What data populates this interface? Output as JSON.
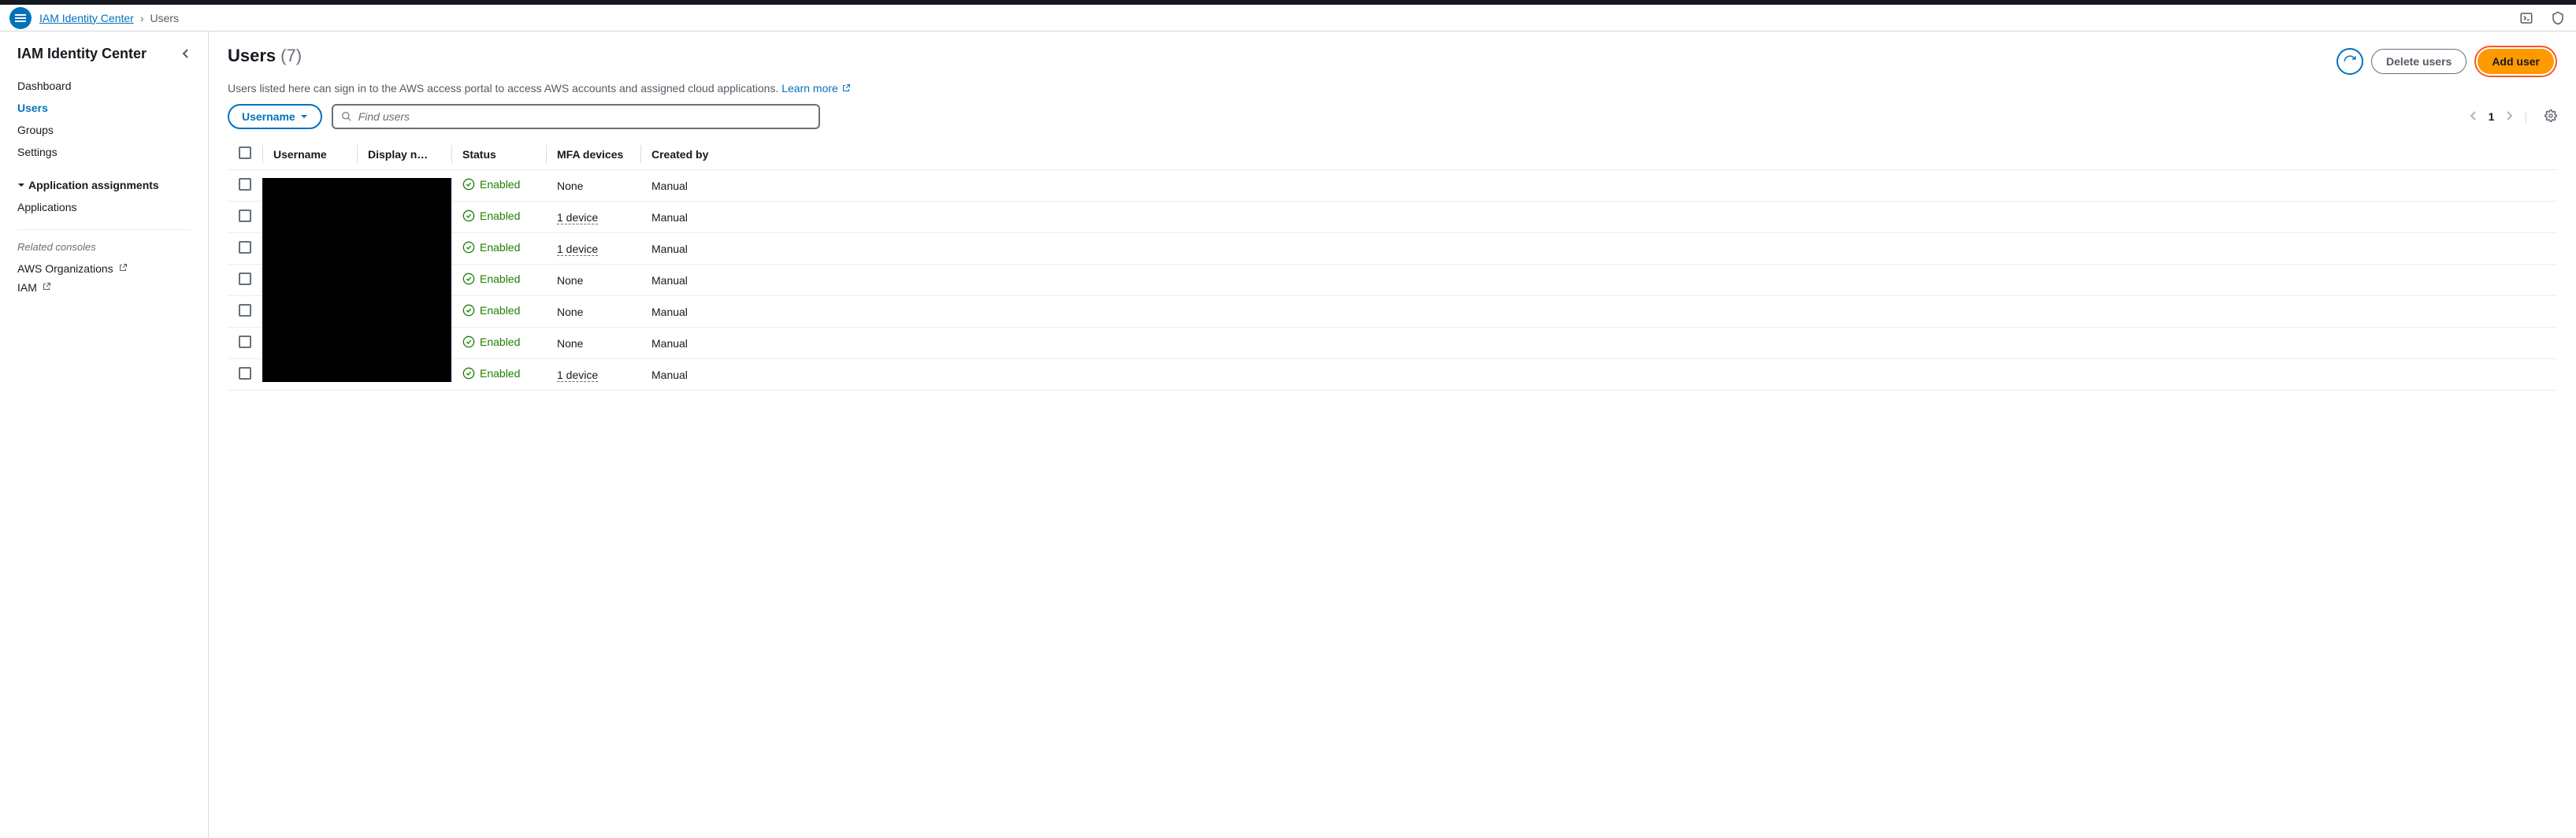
{
  "breadcrumb": {
    "root": "IAM Identity Center",
    "current": "Users"
  },
  "sidebar": {
    "title": "IAM Identity Center",
    "items": [
      {
        "label": "Dashboard",
        "active": false
      },
      {
        "label": "Users",
        "active": true
      },
      {
        "label": "Groups",
        "active": false
      },
      {
        "label": "Settings",
        "active": false
      }
    ],
    "section": "Application assignments",
    "section_items": [
      {
        "label": "Applications"
      }
    ],
    "related_title": "Related consoles",
    "related": [
      {
        "label": "AWS Organizations"
      },
      {
        "label": "IAM"
      }
    ]
  },
  "page": {
    "title": "Users",
    "count": "(7)",
    "description": "Users listed here can sign in to the AWS access portal to access AWS accounts and assigned cloud applications.",
    "learn_more": "Learn more"
  },
  "actions": {
    "delete": "Delete users",
    "add": "Add user"
  },
  "filter": {
    "label": "Username",
    "search_placeholder": "Find users"
  },
  "pagination": {
    "page": "1"
  },
  "table": {
    "headers": {
      "username": "Username",
      "display": "Display n…",
      "status": "Status",
      "mfa": "MFA devices",
      "created": "Created by"
    },
    "rows": [
      {
        "status": "Enabled",
        "mfa": "None",
        "mfa_link": false,
        "created": "Manual"
      },
      {
        "status": "Enabled",
        "mfa": "1 device",
        "mfa_link": true,
        "created": "Manual"
      },
      {
        "status": "Enabled",
        "mfa": "1 device",
        "mfa_link": true,
        "created": "Manual"
      },
      {
        "status": "Enabled",
        "mfa": "None",
        "mfa_link": false,
        "created": "Manual"
      },
      {
        "status": "Enabled",
        "mfa": "None",
        "mfa_link": false,
        "created": "Manual"
      },
      {
        "status": "Enabled",
        "mfa": "None",
        "mfa_link": false,
        "created": "Manual"
      },
      {
        "status": "Enabled",
        "mfa": "1 device",
        "mfa_link": true,
        "created": "Manual"
      }
    ]
  }
}
